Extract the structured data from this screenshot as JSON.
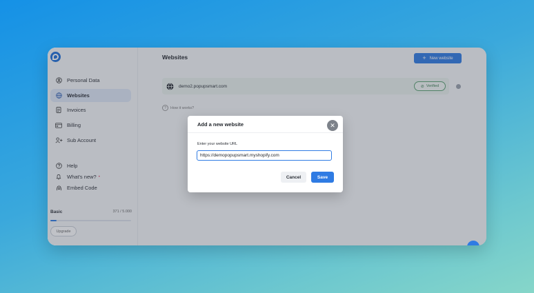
{
  "sidebar": {
    "items": [
      {
        "label": "Personal Data",
        "icon": "user-circle-icon"
      },
      {
        "label": "Websites",
        "icon": "globe-icon",
        "active": true
      },
      {
        "label": "Invoices",
        "icon": "document-icon"
      },
      {
        "label": "Billing",
        "icon": "credit-card-icon"
      },
      {
        "label": "Sub Account",
        "icon": "add-user-icon"
      }
    ],
    "secondary": [
      {
        "label": "Help",
        "icon": "question-icon"
      },
      {
        "label": "What's new?",
        "icon": "bell-icon",
        "badge": "•"
      },
      {
        "label": "Embed Code",
        "icon": "embed-icon"
      }
    ],
    "plan": {
      "name": "Basic",
      "usage": "371 / 5.000",
      "progress": 0.074,
      "upgrade_label": "Upgrade"
    }
  },
  "main": {
    "title": "Websites",
    "new_button": "New website",
    "website": {
      "url": "demo2.popupsmart.com",
      "status": "Verified"
    },
    "how_it_works": "How it works?"
  },
  "modal": {
    "title": "Add a new website",
    "field_label": "Enter your website URL",
    "field_value": "https://demopopupsmart.myshopify.com",
    "cancel_label": "Cancel",
    "save_label": "Save"
  },
  "colors": {
    "accent": "#2f7be3",
    "verified": "#3b7c52"
  }
}
